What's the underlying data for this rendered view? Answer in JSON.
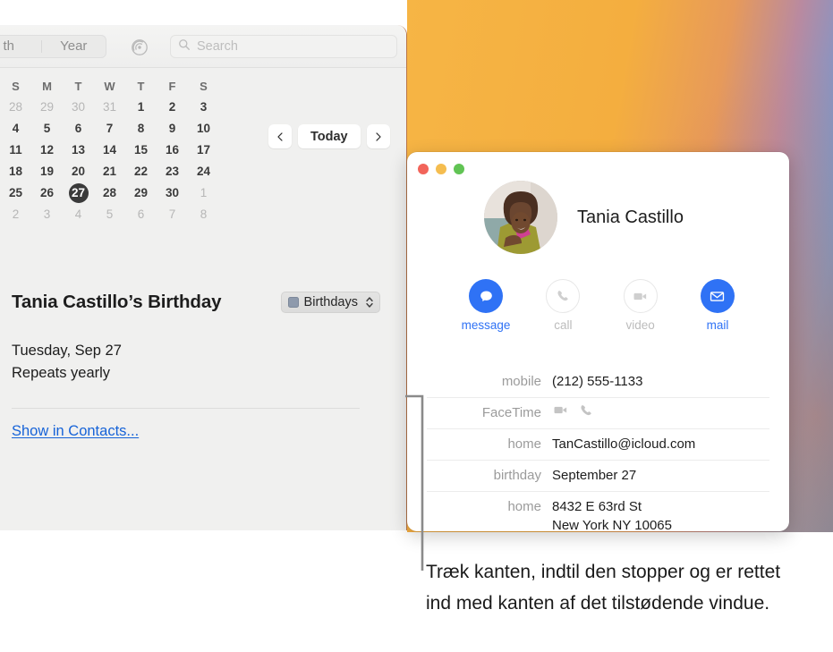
{
  "calendar": {
    "toolbar": {
      "segments": [
        {
          "label": "th",
          "name": "month-segment"
        },
        {
          "label": "Year",
          "name": "year-segment"
        }
      ],
      "location_icon": "radar-icon",
      "search": {
        "placeholder": "Search",
        "value": "",
        "icon": "search-icon"
      }
    },
    "weekday_headers": [
      "S",
      "M",
      "T",
      "W",
      "T",
      "F",
      "S"
    ],
    "weeks": [
      [
        {
          "d": "28",
          "dim": true
        },
        {
          "d": "29",
          "dim": true
        },
        {
          "d": "30",
          "dim": true
        },
        {
          "d": "31",
          "dim": true
        },
        {
          "d": "1",
          "dim": false
        },
        {
          "d": "2",
          "dim": false
        },
        {
          "d": "3",
          "dim": false
        }
      ],
      [
        {
          "d": "4",
          "dim": false
        },
        {
          "d": "5",
          "dim": false
        },
        {
          "d": "6",
          "dim": false
        },
        {
          "d": "7",
          "dim": false
        },
        {
          "d": "8",
          "dim": false
        },
        {
          "d": "9",
          "dim": false
        },
        {
          "d": "10",
          "dim": false
        }
      ],
      [
        {
          "d": "11",
          "dim": false
        },
        {
          "d": "12",
          "dim": false
        },
        {
          "d": "13",
          "dim": false
        },
        {
          "d": "14",
          "dim": false
        },
        {
          "d": "15",
          "dim": false
        },
        {
          "d": "16",
          "dim": false
        },
        {
          "d": "17",
          "dim": false
        }
      ],
      [
        {
          "d": "18",
          "dim": false
        },
        {
          "d": "19",
          "dim": false
        },
        {
          "d": "20",
          "dim": false
        },
        {
          "d": "21",
          "dim": false
        },
        {
          "d": "22",
          "dim": false
        },
        {
          "d": "23",
          "dim": false
        },
        {
          "d": "24",
          "dim": false
        }
      ],
      [
        {
          "d": "25",
          "dim": false
        },
        {
          "d": "26",
          "dim": false
        },
        {
          "d": "27",
          "dim": false,
          "today": true
        },
        {
          "d": "28",
          "dim": false
        },
        {
          "d": "29",
          "dim": false
        },
        {
          "d": "30",
          "dim": false
        },
        {
          "d": "1",
          "dim": true
        }
      ],
      [
        {
          "d": "2",
          "dim": true
        },
        {
          "d": "3",
          "dim": true
        },
        {
          "d": "4",
          "dim": true
        },
        {
          "d": "5",
          "dim": true
        },
        {
          "d": "6",
          "dim": true
        },
        {
          "d": "7",
          "dim": true
        },
        {
          "d": "8",
          "dim": true
        }
      ]
    ],
    "nav": {
      "prev": "‹",
      "today_label": "Today",
      "next": "›"
    },
    "event": {
      "title": "Tania Castillo’s Birthday",
      "calendar_popup": {
        "label": "Birthdays",
        "color": "#8e9aac"
      },
      "date": "Tuesday, Sep 27",
      "repeat": "Repeats yearly",
      "link": "Show in Contacts..."
    }
  },
  "contact_card": {
    "window_controls": [
      "close",
      "minimize",
      "zoom"
    ],
    "name": "Tania Castillo",
    "avatar_name": "contact-avatar",
    "actions": [
      {
        "label": "message",
        "icon": "message-bubble-icon",
        "enabled": true
      },
      {
        "label": "call",
        "icon": "phone-icon",
        "enabled": false
      },
      {
        "label": "video",
        "icon": "video-camera-icon",
        "enabled": false
      },
      {
        "label": "mail",
        "icon": "envelope-icon",
        "enabled": true
      }
    ],
    "fields": [
      {
        "key": "mobile",
        "value": "(212) 555-1133",
        "type": "text"
      },
      {
        "key": "FaceTime",
        "value": "",
        "type": "icons",
        "icons": [
          "video-camera-icon",
          "phone-icon"
        ]
      },
      {
        "key": "home",
        "value": "TanCastillo@icloud.com",
        "type": "text"
      },
      {
        "key": "birthday",
        "value": "September 27",
        "type": "text"
      },
      {
        "key": "home",
        "value": "8432 E 63rd St\nNew York NY 10065",
        "type": "text"
      }
    ]
  },
  "annotation": {
    "caption": "Træk kanten, indtil den stopper og er rettet ind med kanten af det tilstødende vindue."
  },
  "colors": {
    "accent_blue": "#2f72f5",
    "link_blue": "#1663d8",
    "today_badge": "#3a3a3a",
    "calendar_swatch": "#8e9aac"
  }
}
